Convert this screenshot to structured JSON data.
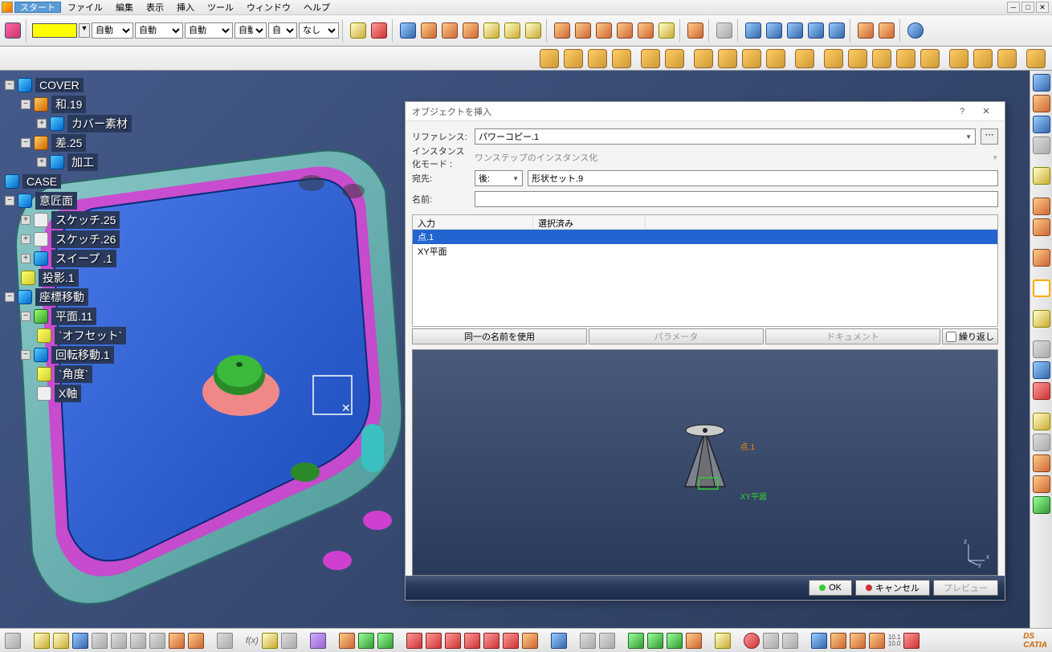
{
  "menu": {
    "start": "スタート",
    "file": "ファイル",
    "edit": "編集",
    "view": "表示",
    "insert": "挿入",
    "tool": "ツール",
    "window": "ウィンドウ",
    "help": "ヘルプ"
  },
  "selects": {
    "s1": "自動",
    "s2": "自動",
    "s3": "自動",
    "s4": "自動",
    "s5": "自",
    "s6": "なし"
  },
  "tree": {
    "n0": "COVER",
    "n1": "和.19",
    "n2": "カバー素材",
    "n3": "差.25",
    "n4": "加工",
    "n5": "CASE",
    "n6": "意匠面",
    "n7": "スケッチ.25",
    "n8": "スケッチ.26",
    "n9": "スイープ .1",
    "n10": "投影.1",
    "n11": "座標移動",
    "n12": "平面.11",
    "n13": "`オフセット`",
    "n14": "回転移動.1",
    "n15": "`角度`",
    "n16": "X軸"
  },
  "dialog": {
    "title": "オブジェクトを挿入",
    "labels": {
      "reference": "リファレンス:",
      "instmode": "インスタンス化モード :",
      "destination": "宛先:",
      "name": "名前:",
      "input": "入力",
      "selected": "選択済み"
    },
    "reference_val": "パワーコピー.1",
    "instmode_val": "ワンステップのインスタンス化",
    "dest_combo": "後:",
    "dest_val": "形状セット.9",
    "name_val": "",
    "list": {
      "row1": "点.1",
      "row2": "XY平面"
    },
    "buttons": {
      "samename": "同一の名前を使用",
      "param": "パラメータ",
      "doc": "ドキュメント",
      "repeat": "繰り返し"
    },
    "preview": {
      "label1": "点.1",
      "label2": "XY平面"
    },
    "triad": {
      "z": "z",
      "y": "y",
      "x": "x"
    },
    "footer": {
      "ok": "OK",
      "cancel": "キャンセル",
      "preview": "プレビュー"
    }
  },
  "bottom": {
    "ratio": "10.1\n10.0"
  }
}
